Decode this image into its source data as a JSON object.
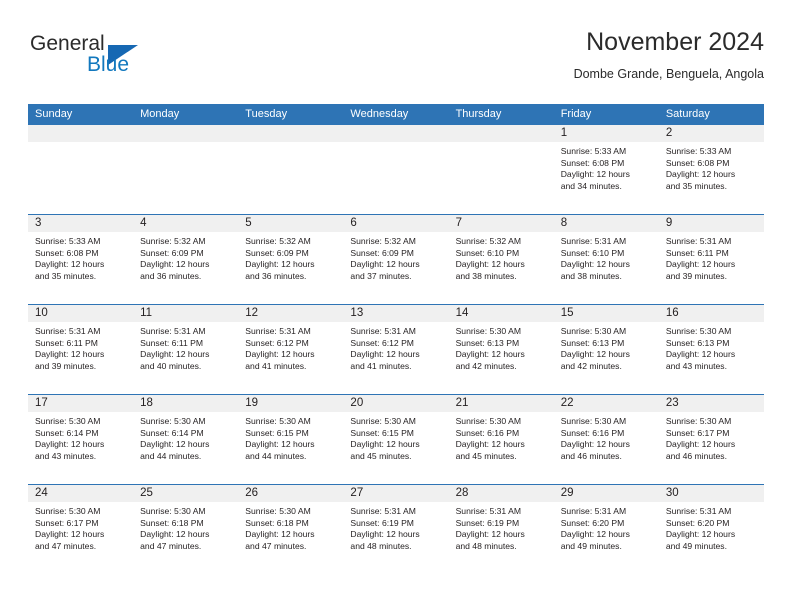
{
  "brand": {
    "name_part1": "General",
    "name_part2": "Blue",
    "triangle_color": "#1668b3",
    "blue_text_color": "#1278be"
  },
  "header": {
    "title": "November 2024",
    "subtitle": "Dombe Grande, Benguela, Angola"
  },
  "theme": {
    "header_blue": "#2e74b5",
    "datebar_gray": "#f0f0f0",
    "text_color": "#231f20"
  },
  "weekdays": [
    "Sunday",
    "Monday",
    "Tuesday",
    "Wednesday",
    "Thursday",
    "Friday",
    "Saturday"
  ],
  "weeks": [
    [
      {
        "date": "",
        "sunrise": "",
        "sunset": "",
        "daylight1": "",
        "daylight2": ""
      },
      {
        "date": "",
        "sunrise": "",
        "sunset": "",
        "daylight1": "",
        "daylight2": ""
      },
      {
        "date": "",
        "sunrise": "",
        "sunset": "",
        "daylight1": "",
        "daylight2": ""
      },
      {
        "date": "",
        "sunrise": "",
        "sunset": "",
        "daylight1": "",
        "daylight2": ""
      },
      {
        "date": "",
        "sunrise": "",
        "sunset": "",
        "daylight1": "",
        "daylight2": ""
      },
      {
        "date": "1",
        "sunrise": "Sunrise: 5:33 AM",
        "sunset": "Sunset: 6:08 PM",
        "daylight1": "Daylight: 12 hours",
        "daylight2": "and 34 minutes."
      },
      {
        "date": "2",
        "sunrise": "Sunrise: 5:33 AM",
        "sunset": "Sunset: 6:08 PM",
        "daylight1": "Daylight: 12 hours",
        "daylight2": "and 35 minutes."
      }
    ],
    [
      {
        "date": "3",
        "sunrise": "Sunrise: 5:33 AM",
        "sunset": "Sunset: 6:08 PM",
        "daylight1": "Daylight: 12 hours",
        "daylight2": "and 35 minutes."
      },
      {
        "date": "4",
        "sunrise": "Sunrise: 5:32 AM",
        "sunset": "Sunset: 6:09 PM",
        "daylight1": "Daylight: 12 hours",
        "daylight2": "and 36 minutes."
      },
      {
        "date": "5",
        "sunrise": "Sunrise: 5:32 AM",
        "sunset": "Sunset: 6:09 PM",
        "daylight1": "Daylight: 12 hours",
        "daylight2": "and 36 minutes."
      },
      {
        "date": "6",
        "sunrise": "Sunrise: 5:32 AM",
        "sunset": "Sunset: 6:09 PM",
        "daylight1": "Daylight: 12 hours",
        "daylight2": "and 37 minutes."
      },
      {
        "date": "7",
        "sunrise": "Sunrise: 5:32 AM",
        "sunset": "Sunset: 6:10 PM",
        "daylight1": "Daylight: 12 hours",
        "daylight2": "and 38 minutes."
      },
      {
        "date": "8",
        "sunrise": "Sunrise: 5:31 AM",
        "sunset": "Sunset: 6:10 PM",
        "daylight1": "Daylight: 12 hours",
        "daylight2": "and 38 minutes."
      },
      {
        "date": "9",
        "sunrise": "Sunrise: 5:31 AM",
        "sunset": "Sunset: 6:11 PM",
        "daylight1": "Daylight: 12 hours",
        "daylight2": "and 39 minutes."
      }
    ],
    [
      {
        "date": "10",
        "sunrise": "Sunrise: 5:31 AM",
        "sunset": "Sunset: 6:11 PM",
        "daylight1": "Daylight: 12 hours",
        "daylight2": "and 39 minutes."
      },
      {
        "date": "11",
        "sunrise": "Sunrise: 5:31 AM",
        "sunset": "Sunset: 6:11 PM",
        "daylight1": "Daylight: 12 hours",
        "daylight2": "and 40 minutes."
      },
      {
        "date": "12",
        "sunrise": "Sunrise: 5:31 AM",
        "sunset": "Sunset: 6:12 PM",
        "daylight1": "Daylight: 12 hours",
        "daylight2": "and 41 minutes."
      },
      {
        "date": "13",
        "sunrise": "Sunrise: 5:31 AM",
        "sunset": "Sunset: 6:12 PM",
        "daylight1": "Daylight: 12 hours",
        "daylight2": "and 41 minutes."
      },
      {
        "date": "14",
        "sunrise": "Sunrise: 5:30 AM",
        "sunset": "Sunset: 6:13 PM",
        "daylight1": "Daylight: 12 hours",
        "daylight2": "and 42 minutes."
      },
      {
        "date": "15",
        "sunrise": "Sunrise: 5:30 AM",
        "sunset": "Sunset: 6:13 PM",
        "daylight1": "Daylight: 12 hours",
        "daylight2": "and 42 minutes."
      },
      {
        "date": "16",
        "sunrise": "Sunrise: 5:30 AM",
        "sunset": "Sunset: 6:13 PM",
        "daylight1": "Daylight: 12 hours",
        "daylight2": "and 43 minutes."
      }
    ],
    [
      {
        "date": "17",
        "sunrise": "Sunrise: 5:30 AM",
        "sunset": "Sunset: 6:14 PM",
        "daylight1": "Daylight: 12 hours",
        "daylight2": "and 43 minutes."
      },
      {
        "date": "18",
        "sunrise": "Sunrise: 5:30 AM",
        "sunset": "Sunset: 6:14 PM",
        "daylight1": "Daylight: 12 hours",
        "daylight2": "and 44 minutes."
      },
      {
        "date": "19",
        "sunrise": "Sunrise: 5:30 AM",
        "sunset": "Sunset: 6:15 PM",
        "daylight1": "Daylight: 12 hours",
        "daylight2": "and 44 minutes."
      },
      {
        "date": "20",
        "sunrise": "Sunrise: 5:30 AM",
        "sunset": "Sunset: 6:15 PM",
        "daylight1": "Daylight: 12 hours",
        "daylight2": "and 45 minutes."
      },
      {
        "date": "21",
        "sunrise": "Sunrise: 5:30 AM",
        "sunset": "Sunset: 6:16 PM",
        "daylight1": "Daylight: 12 hours",
        "daylight2": "and 45 minutes."
      },
      {
        "date": "22",
        "sunrise": "Sunrise: 5:30 AM",
        "sunset": "Sunset: 6:16 PM",
        "daylight1": "Daylight: 12 hours",
        "daylight2": "and 46 minutes."
      },
      {
        "date": "23",
        "sunrise": "Sunrise: 5:30 AM",
        "sunset": "Sunset: 6:17 PM",
        "daylight1": "Daylight: 12 hours",
        "daylight2": "and 46 minutes."
      }
    ],
    [
      {
        "date": "24",
        "sunrise": "Sunrise: 5:30 AM",
        "sunset": "Sunset: 6:17 PM",
        "daylight1": "Daylight: 12 hours",
        "daylight2": "and 47 minutes."
      },
      {
        "date": "25",
        "sunrise": "Sunrise: 5:30 AM",
        "sunset": "Sunset: 6:18 PM",
        "daylight1": "Daylight: 12 hours",
        "daylight2": "and 47 minutes."
      },
      {
        "date": "26",
        "sunrise": "Sunrise: 5:30 AM",
        "sunset": "Sunset: 6:18 PM",
        "daylight1": "Daylight: 12 hours",
        "daylight2": "and 47 minutes."
      },
      {
        "date": "27",
        "sunrise": "Sunrise: 5:31 AM",
        "sunset": "Sunset: 6:19 PM",
        "daylight1": "Daylight: 12 hours",
        "daylight2": "and 48 minutes."
      },
      {
        "date": "28",
        "sunrise": "Sunrise: 5:31 AM",
        "sunset": "Sunset: 6:19 PM",
        "daylight1": "Daylight: 12 hours",
        "daylight2": "and 48 minutes."
      },
      {
        "date": "29",
        "sunrise": "Sunrise: 5:31 AM",
        "sunset": "Sunset: 6:20 PM",
        "daylight1": "Daylight: 12 hours",
        "daylight2": "and 49 minutes."
      },
      {
        "date": "30",
        "sunrise": "Sunrise: 5:31 AM",
        "sunset": "Sunset: 6:20 PM",
        "daylight1": "Daylight: 12 hours",
        "daylight2": "and 49 minutes."
      }
    ]
  ]
}
